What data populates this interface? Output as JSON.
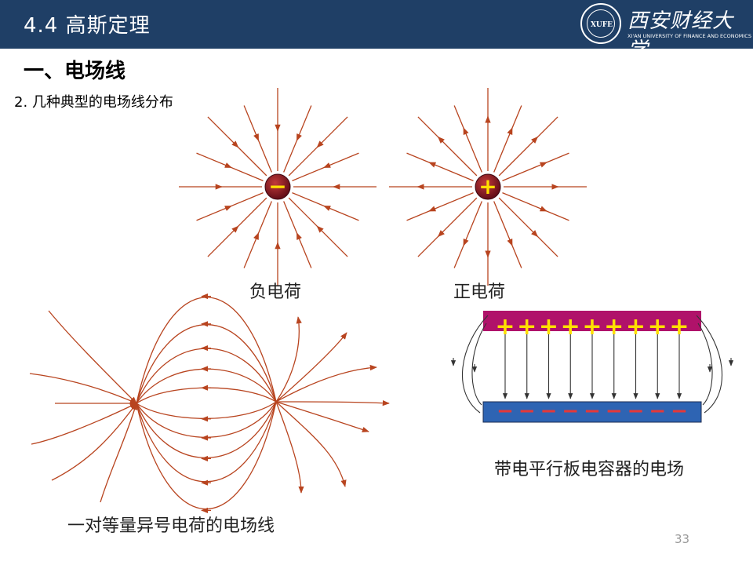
{
  "header": {
    "title": "4.4  高斯定理",
    "logo_text": "XUFE",
    "logo_cn": "西安财经大学",
    "logo_en": "XI'AN UNIVERSITY OF FINANCE AND ECONOMICS"
  },
  "section": {
    "heading": "一、电场线",
    "subheading": "2. 几种典型的电场线分布"
  },
  "figures": {
    "negative": {
      "caption": "负电荷",
      "symbol": "−"
    },
    "positive": {
      "caption": "正电荷",
      "symbol": "+"
    },
    "dipole": {
      "caption": "一对等量异号电荷的电场线"
    },
    "capacitor": {
      "caption": "带电平行板电容器的电场",
      "top_symbol": "+",
      "bottom_symbol": "−"
    }
  },
  "colors": {
    "header_bg": "#1f3f66",
    "field_line": "#b8441f",
    "top_plate": "#b0126a",
    "bottom_plate": "#2e64b3",
    "plate_sign": "#ffe000",
    "bottom_sign": "#e53838"
  },
  "page_number": "33"
}
